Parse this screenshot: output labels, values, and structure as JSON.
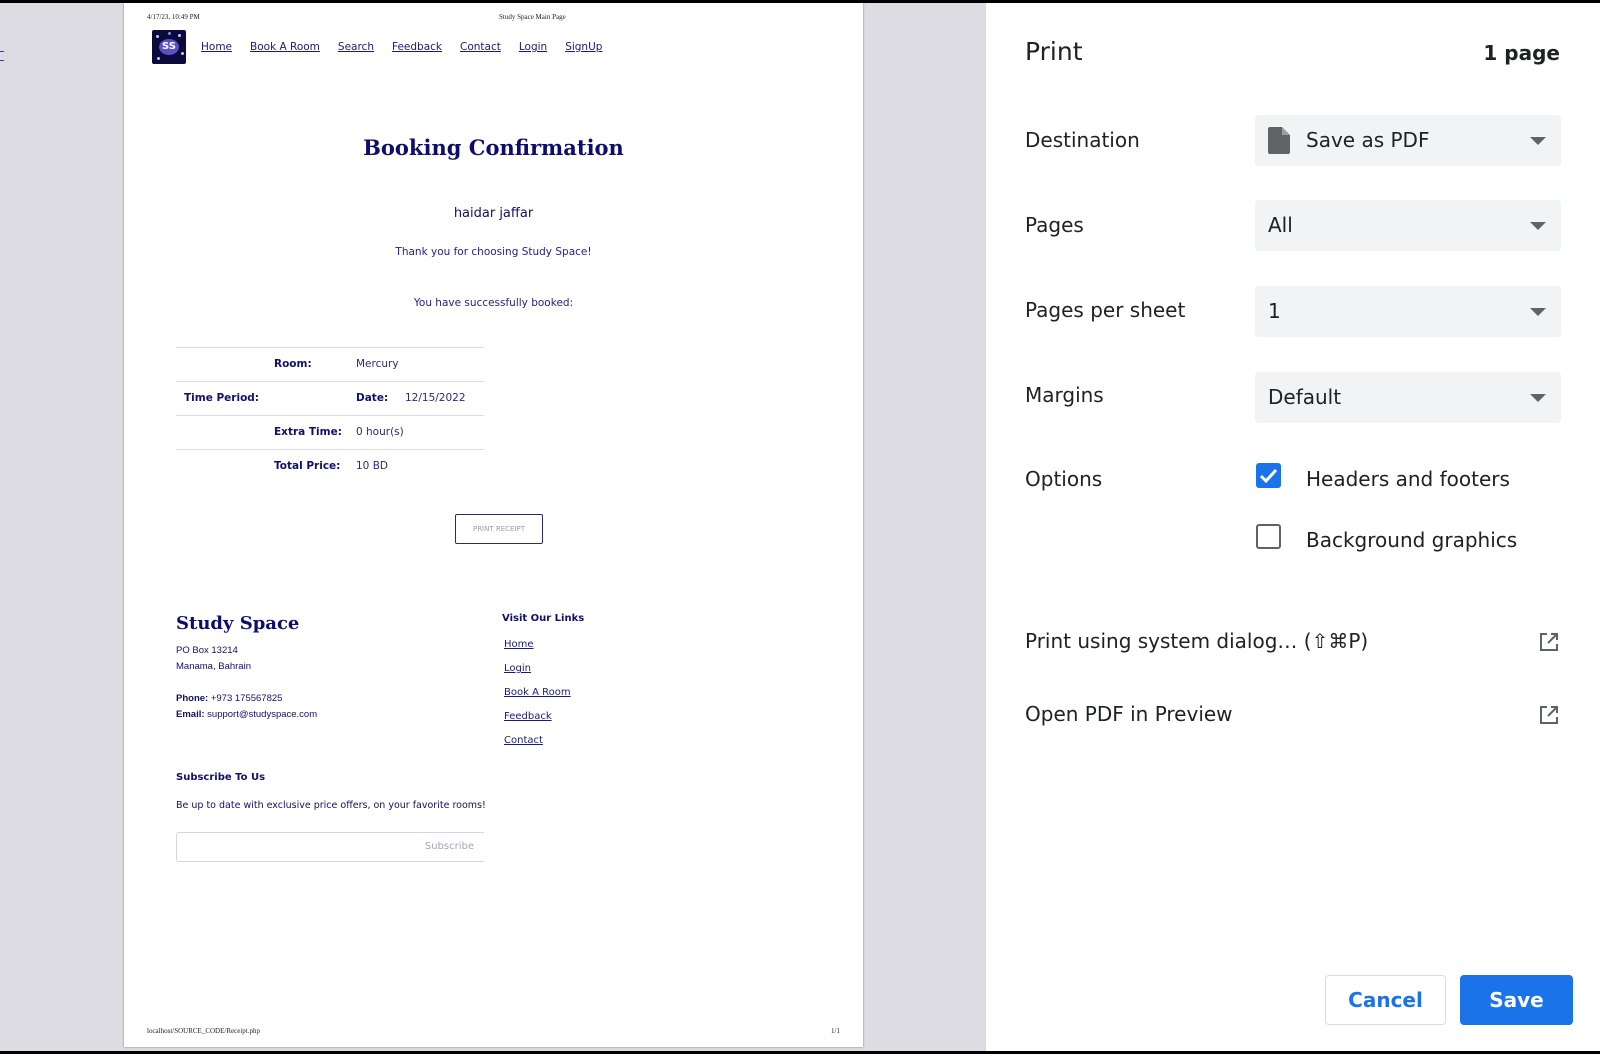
{
  "sheet": {
    "header": {
      "date": "4/17/23, 10:49 PM",
      "title": "Study Space Main Page"
    },
    "footer": {
      "url": "localhost/SOURCE_CODE/Receipt.php",
      "page": "1/1"
    },
    "logo": {
      "text": "SS"
    },
    "nav": [
      "Home",
      "Book A Room",
      "Search",
      "Feedback",
      "Contact",
      "Login",
      "SignUp"
    ],
    "booking": {
      "title": "Booking Confirmation",
      "name": "haidar jaffar",
      "thanks": "Thank you for choosing Study Space!",
      "booked": "You have successfully booked:",
      "room_label": "Room:",
      "room_value": "Mercury",
      "period_label": "Time Period:",
      "date_label": "Date:",
      "date_value": "12/15/2022",
      "extra_label": "Extra Time:",
      "extra_value": "0 hour(s)",
      "price_label": "Total Price:",
      "price_value": "10 BD",
      "print_button": "PRINT RECEIPT"
    },
    "site_footer": {
      "brand": "Study Space",
      "address1": "PO Box 13214",
      "address2": "Manama, Bahrain",
      "phone_label": "Phone:",
      "phone_value": "+973 175567825",
      "email_label": "Email:",
      "email_value": "support@studyspace.com",
      "links_heading": "Visit Our Links",
      "links": [
        "Home",
        "Login",
        "Book A Room",
        "Feedback",
        "Contact"
      ],
      "subscribe_heading": "Subscribe To Us",
      "subscribe_text": "Be up to date with exclusive price offers, on your favorite rooms!",
      "subscribe_button": "Subscribe"
    }
  },
  "panel": {
    "title": "Print",
    "page_count": "1 page",
    "destination_label": "Destination",
    "destination_value": "Save as PDF",
    "pages_label": "Pages",
    "pages_value": "All",
    "pps_label": "Pages per sheet",
    "pps_value": "1",
    "margins_label": "Margins",
    "margins_value": "Default",
    "options_label": "Options",
    "headers_footers": {
      "label": "Headers and footers",
      "checked": true
    },
    "background_graphics": {
      "label": "Background graphics",
      "checked": false
    },
    "system_dialog": "Print using system dialog… (⇧⌘P)",
    "open_preview": "Open PDF in Preview",
    "cancel": "Cancel",
    "save": "Save"
  },
  "colors": {
    "accent": "#1a73e8",
    "site_navy": "#0d0d6e",
    "preview_bg": "#dcdce2"
  },
  "icons": [
    "document-icon",
    "dropdown-arrow-icon",
    "checkmark-icon",
    "external-link-icon"
  ]
}
